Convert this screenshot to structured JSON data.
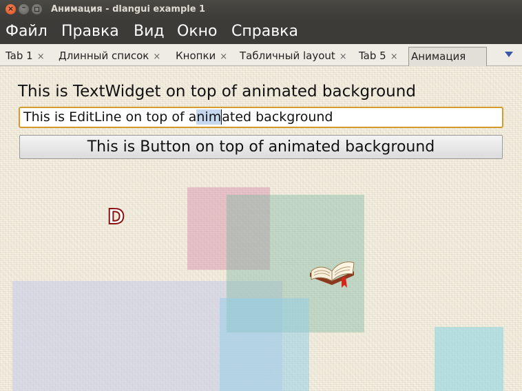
{
  "window": {
    "title": "Анимация - dlangui example 1"
  },
  "menu": {
    "items": [
      "Файл",
      "Правка",
      "Вид",
      "Окно",
      "Справка"
    ]
  },
  "tabs": {
    "items": [
      {
        "label": "Tab 1"
      },
      {
        "label": "Длинный список"
      },
      {
        "label": "Кнопки"
      },
      {
        "label": "Табличный layout"
      },
      {
        "label": "Tab 5"
      },
      {
        "label": "Анимация"
      }
    ],
    "close_glyph": "×",
    "active": "Анимация"
  },
  "content": {
    "text_widget": "This is TextWidget on top of animated background",
    "edit_line": {
      "before": "This is EditLine on top of a",
      "selected": "nim",
      "after": "ated background"
    },
    "button_label": "This is Button on top of animated background",
    "d_logo": "D"
  },
  "colors": {
    "pink": "#d88fac",
    "green": "#7fb7a2",
    "lavender": "#c9cde8",
    "light_blue": "#a6d1ee",
    "cyan": "#8fd6e2"
  }
}
